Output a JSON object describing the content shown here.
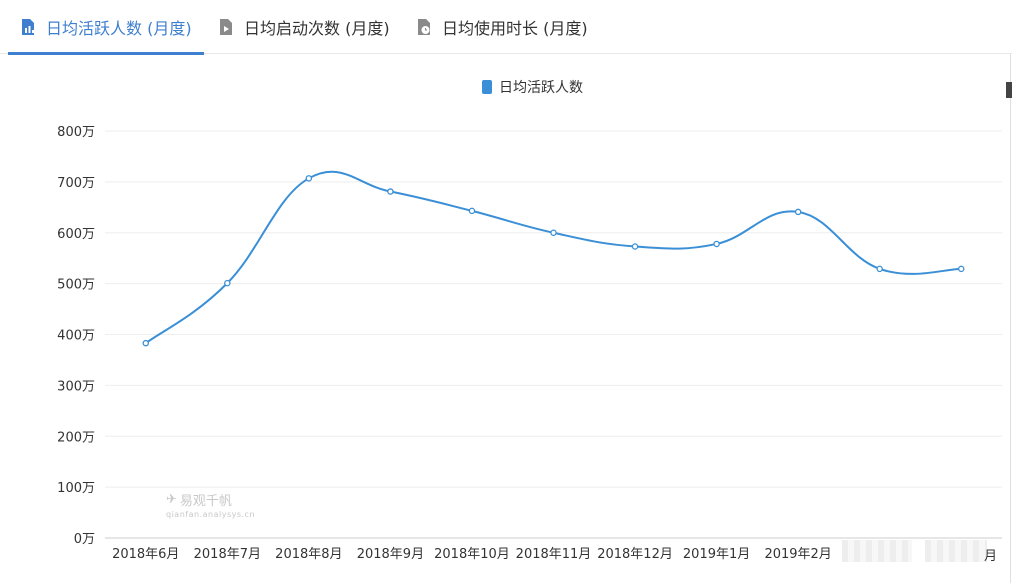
{
  "tabs": [
    {
      "label": "日均活跃人数 (月度)",
      "active": true,
      "icon": "chart-doc-icon"
    },
    {
      "label": "日均启动次数 (月度)",
      "active": false,
      "icon": "play-doc-icon"
    },
    {
      "label": "日均使用时长 (月度)",
      "active": false,
      "icon": "clock-doc-icon"
    }
  ],
  "colors": {
    "accent": "#3f7fcf",
    "series": "#3a8fd6"
  },
  "watermark": {
    "title": "易观千帆",
    "subtitle": "qianfan.analysys.cn"
  },
  "last_label_fragment": "月",
  "chart_data": {
    "type": "line",
    "smooth": true,
    "legend": "top-center",
    "grid": true,
    "categories": [
      "2018年6月",
      "2018年7月",
      "2018年8月",
      "2018年9月",
      "2018年10月",
      "2018年11月",
      "2018年12月",
      "2019年1月",
      "2019年2月",
      "",
      ""
    ],
    "series": [
      {
        "name": "日均活跃人数",
        "values": [
          383,
          501,
          707,
          681,
          643,
          600,
          573,
          578,
          641,
          529,
          529
        ]
      }
    ],
    "y_ticks": [
      "0万",
      "100万",
      "200万",
      "300万",
      "400万",
      "500万",
      "600万",
      "700万",
      "800万"
    ],
    "ylim": [
      0,
      800
    ],
    "unit": "万"
  }
}
